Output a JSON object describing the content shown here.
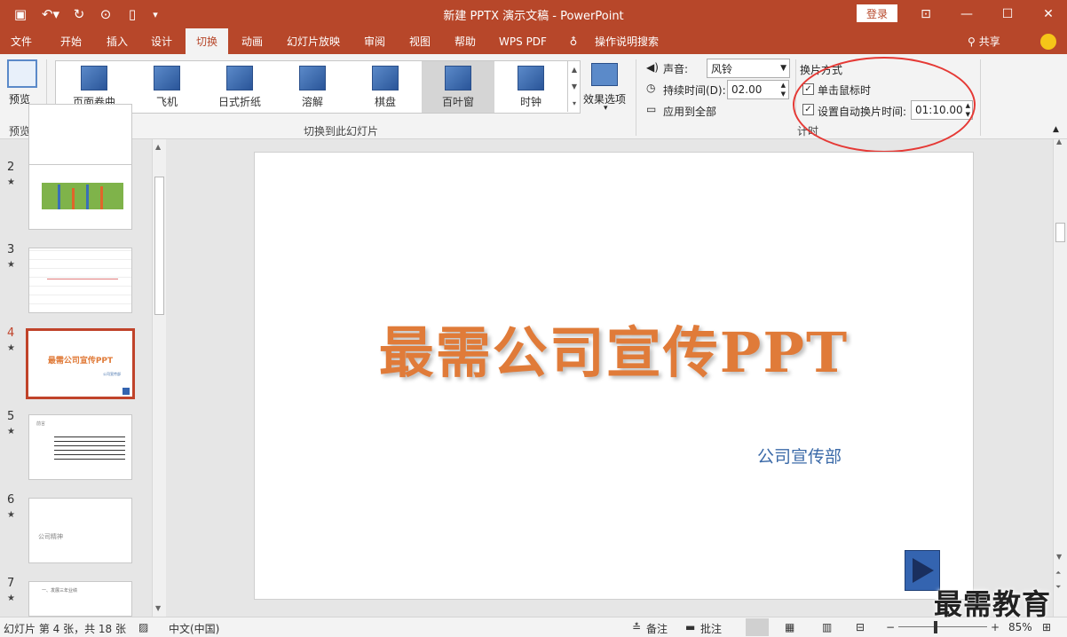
{
  "window": {
    "title": "新建 PPTX 演示文稿 - PowerPoint",
    "login_label": "登录"
  },
  "tabs": [
    {
      "label": "文件"
    },
    {
      "label": "开始"
    },
    {
      "label": "插入"
    },
    {
      "label": "设计"
    },
    {
      "label": "切换"
    },
    {
      "label": "动画"
    },
    {
      "label": "幻灯片放映"
    },
    {
      "label": "审阅"
    },
    {
      "label": "视图"
    },
    {
      "label": "帮助"
    },
    {
      "label": "WPS PDF"
    },
    {
      "label": "操作说明搜索"
    }
  ],
  "share_label": "共享",
  "ribbon": {
    "preview_label": "预览",
    "preview_group": "预览",
    "transitions": [
      {
        "label": "页面卷曲"
      },
      {
        "label": "飞机"
      },
      {
        "label": "日式折纸"
      },
      {
        "label": "溶解"
      },
      {
        "label": "棋盘"
      },
      {
        "label": "百叶窗"
      },
      {
        "label": "时钟"
      }
    ],
    "effect_options_label": "效果选项",
    "transition_group": "切换到此幻灯片",
    "timing": {
      "sound_label": "声音:",
      "sound_value": "风铃",
      "duration_label": "持续时间(D):",
      "duration_value": "02.00",
      "apply_all_label": "应用到全部",
      "advance_label": "换片方式",
      "on_click_label": "单击鼠标时",
      "after_label": "设置自动换片时间:",
      "after_value": "01:10.00",
      "group": "计时"
    }
  },
  "slides_pane": [
    {
      "num": "2",
      "star": "★"
    },
    {
      "num": "3",
      "star": "★"
    },
    {
      "num": "4",
      "star": "★",
      "title": "最需公司宣传PPT",
      "sub": "公司宣传部"
    },
    {
      "num": "5",
      "star": "★",
      "title": "前言"
    },
    {
      "num": "6",
      "star": "★",
      "title": "公司精神"
    },
    {
      "num": "7",
      "star": "★",
      "title": "一、发展三年业绩"
    }
  ],
  "slide": {
    "title": "最需公司宣传PPT",
    "subtitle": "公司宣传部"
  },
  "status": {
    "slide_info": "幻灯片 第 4 张，共 18 张",
    "language": "中文(中国)",
    "notes": "备注",
    "comments": "批注",
    "zoom": "85%"
  },
  "watermark": "最需教育",
  "colors": {
    "accent": "#b7472a",
    "title": "#e07b39",
    "subtitle": "#3b6aa8"
  }
}
